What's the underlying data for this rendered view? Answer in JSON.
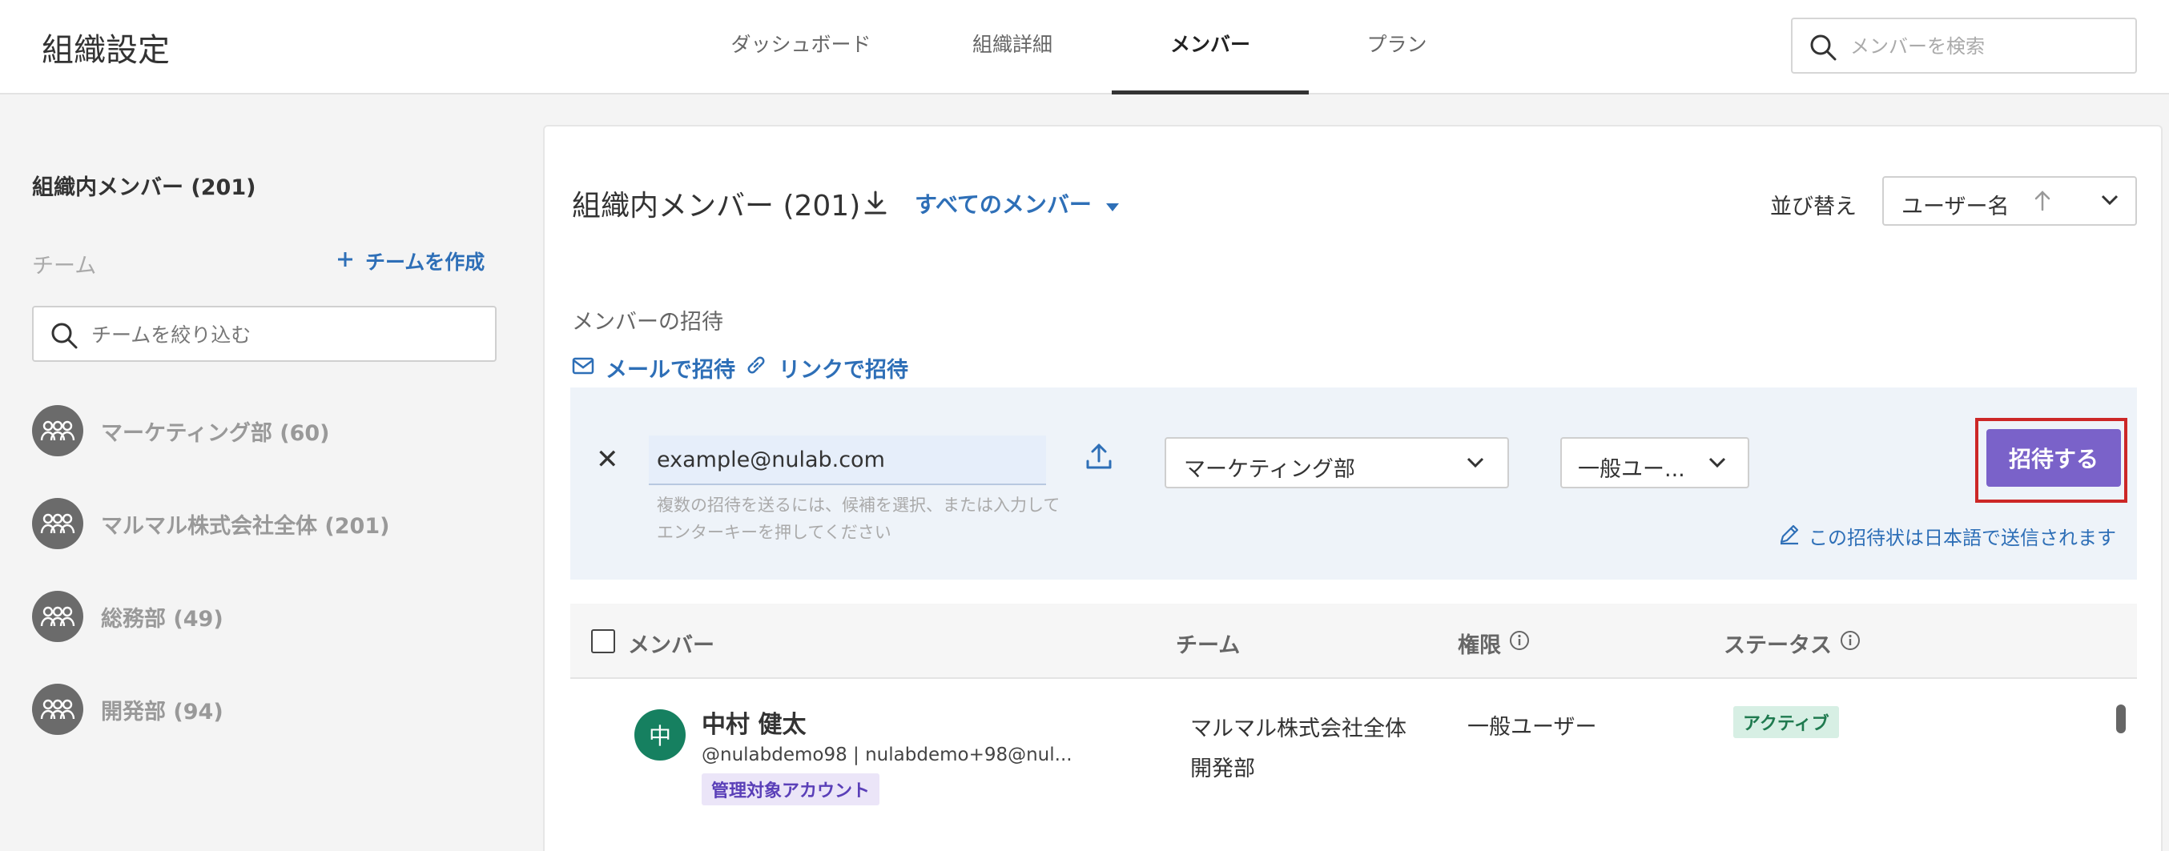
{
  "header": {
    "title": "組織設定",
    "tabs": [
      {
        "label": "ダッシュボード"
      },
      {
        "label": "組織詳細"
      },
      {
        "label": "メンバー"
      },
      {
        "label": "プラン"
      }
    ],
    "search_placeholder": "メンバーを検索"
  },
  "sidebar": {
    "title": "組織内メンバー (201)",
    "team_label": "チーム",
    "create_team": "チームを作成",
    "filter_placeholder": "チームを絞り込む",
    "teams": [
      {
        "name": "マーケティング部 (60)"
      },
      {
        "name": "マルマル株式会社全体 (201)"
      },
      {
        "name": "総務部 (49)"
      },
      {
        "name": "開発部 (94)"
      }
    ]
  },
  "main": {
    "title": "組織内メンバー (201)",
    "filter_label": "すべてのメンバー",
    "sort_label": "並び替え",
    "sort_value": "ユーザー名",
    "invite": {
      "section_label": "メンバーの招待",
      "by_email": "メールで招待",
      "by_link": "リンクで招待",
      "email_value": "example@nulab.com",
      "email_hint": "複数の招待を送るには、候補を選択、または入力してエンターキーを押してください",
      "team_value": "マーケティング部",
      "role_value": "一般ユー...",
      "button": "招待する",
      "language_note": "この招待状は日本語で送信されます"
    },
    "table": {
      "headers": {
        "member": "メンバー",
        "team": "チーム",
        "role": "権限",
        "status": "ステータス"
      },
      "rows": [
        {
          "avatar_initial": "中",
          "name": "中村 健太",
          "sub": "@nulabdemo98 | nulabdemo+98@nul...",
          "badge": "管理対象アカウント",
          "team_line1": "マルマル株式会社全体",
          "team_line2": "開発部",
          "role": "一般ユーザー",
          "status": "アクティブ"
        }
      ]
    }
  },
  "colors": {
    "link": "#2e6fb7",
    "primary_button": "#7a62c9",
    "highlight_outline": "#cc2727",
    "avatar_member": "#168060",
    "status_active_bg": "#d7efe4"
  }
}
